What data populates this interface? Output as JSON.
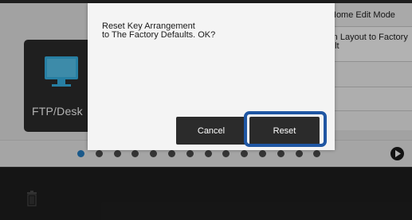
{
  "menu": {
    "items": [
      {
        "label": "Home Edit Mode"
      },
      {
        "label": "rn Layout to Factory\nult"
      },
      {
        "label": ""
      },
      {
        "label": ""
      },
      {
        "label": ""
      }
    ]
  },
  "tile": {
    "label": "FTP/Desk",
    "icon": "monitor-icon"
  },
  "pager": {
    "page_count": 14,
    "current_page": 1,
    "next_icon": "play-icon"
  },
  "dialog": {
    "message": "Reset Key Arrangement\nto The Factory Defaults. OK?",
    "cancel_label": "Cancel",
    "reset_label": "Reset"
  },
  "bottom": {
    "icon": "trash-icon"
  },
  "colors": {
    "highlight": "#1f56a3",
    "active_dot": "#2680c6",
    "button_bg": "#2b2b2b",
    "dialog_bg": "#f4f4f4"
  }
}
